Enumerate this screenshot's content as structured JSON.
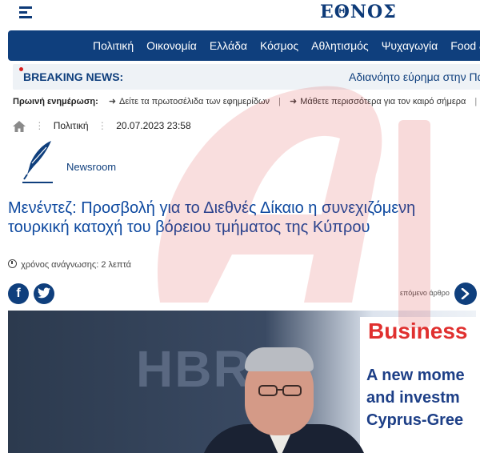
{
  "header": {
    "logo": "ΕΘΝΟΣ"
  },
  "nav": {
    "items": [
      "Πολιτική",
      "Οικονομία",
      "Ελλάδα",
      "Κόσμος",
      "Αθλητισμός",
      "Ψυχαγωγία",
      "Food &"
    ]
  },
  "breaking": {
    "label": "BREAKING NEWS:",
    "text": "Αδιανόητο εύρημα στην Πά"
  },
  "morning": {
    "label": "Πρωινή ενημέρωση:",
    "link1": "Δείτε τα πρωτοσέλιδα των εφημερίδων",
    "separator": "|",
    "link2": "Μάθετε περισσότερα για τον καιρό σήμερα",
    "separator2": "|"
  },
  "meta": {
    "category": "Πολιτική",
    "date": "20.07.2023 23:58"
  },
  "author": {
    "name": "Newsroom"
  },
  "article": {
    "title": "Μενέντεζ: Προσβολή για το Διεθνές Δίκαιο η συνεχιζόμενη τουρκική κατοχή του βόρειου τμήματος της Κύπρου",
    "read_time": "χρόνος ανάγνωσης: 2 λεπτά"
  },
  "share": {
    "facebook": "f",
    "next_label": "επόμενο άρθρο"
  },
  "hero_image": {
    "banner_line1": "Business",
    "banner_line2": "A new mome",
    "banner_line3": "and investm",
    "banner_line4": "Cyprus-Gree",
    "logo_text": "HBR"
  },
  "colors": {
    "brand": "#0f3f7d",
    "headline": "#0f4aa0",
    "breaking_bg": "#eef2f6",
    "accent_red": "#d81e1e"
  },
  "icons": [
    "hamburger-icon",
    "home-icon",
    "quill-icon",
    "clock-icon",
    "facebook-icon",
    "twitter-icon",
    "chevron-right-icon"
  ]
}
